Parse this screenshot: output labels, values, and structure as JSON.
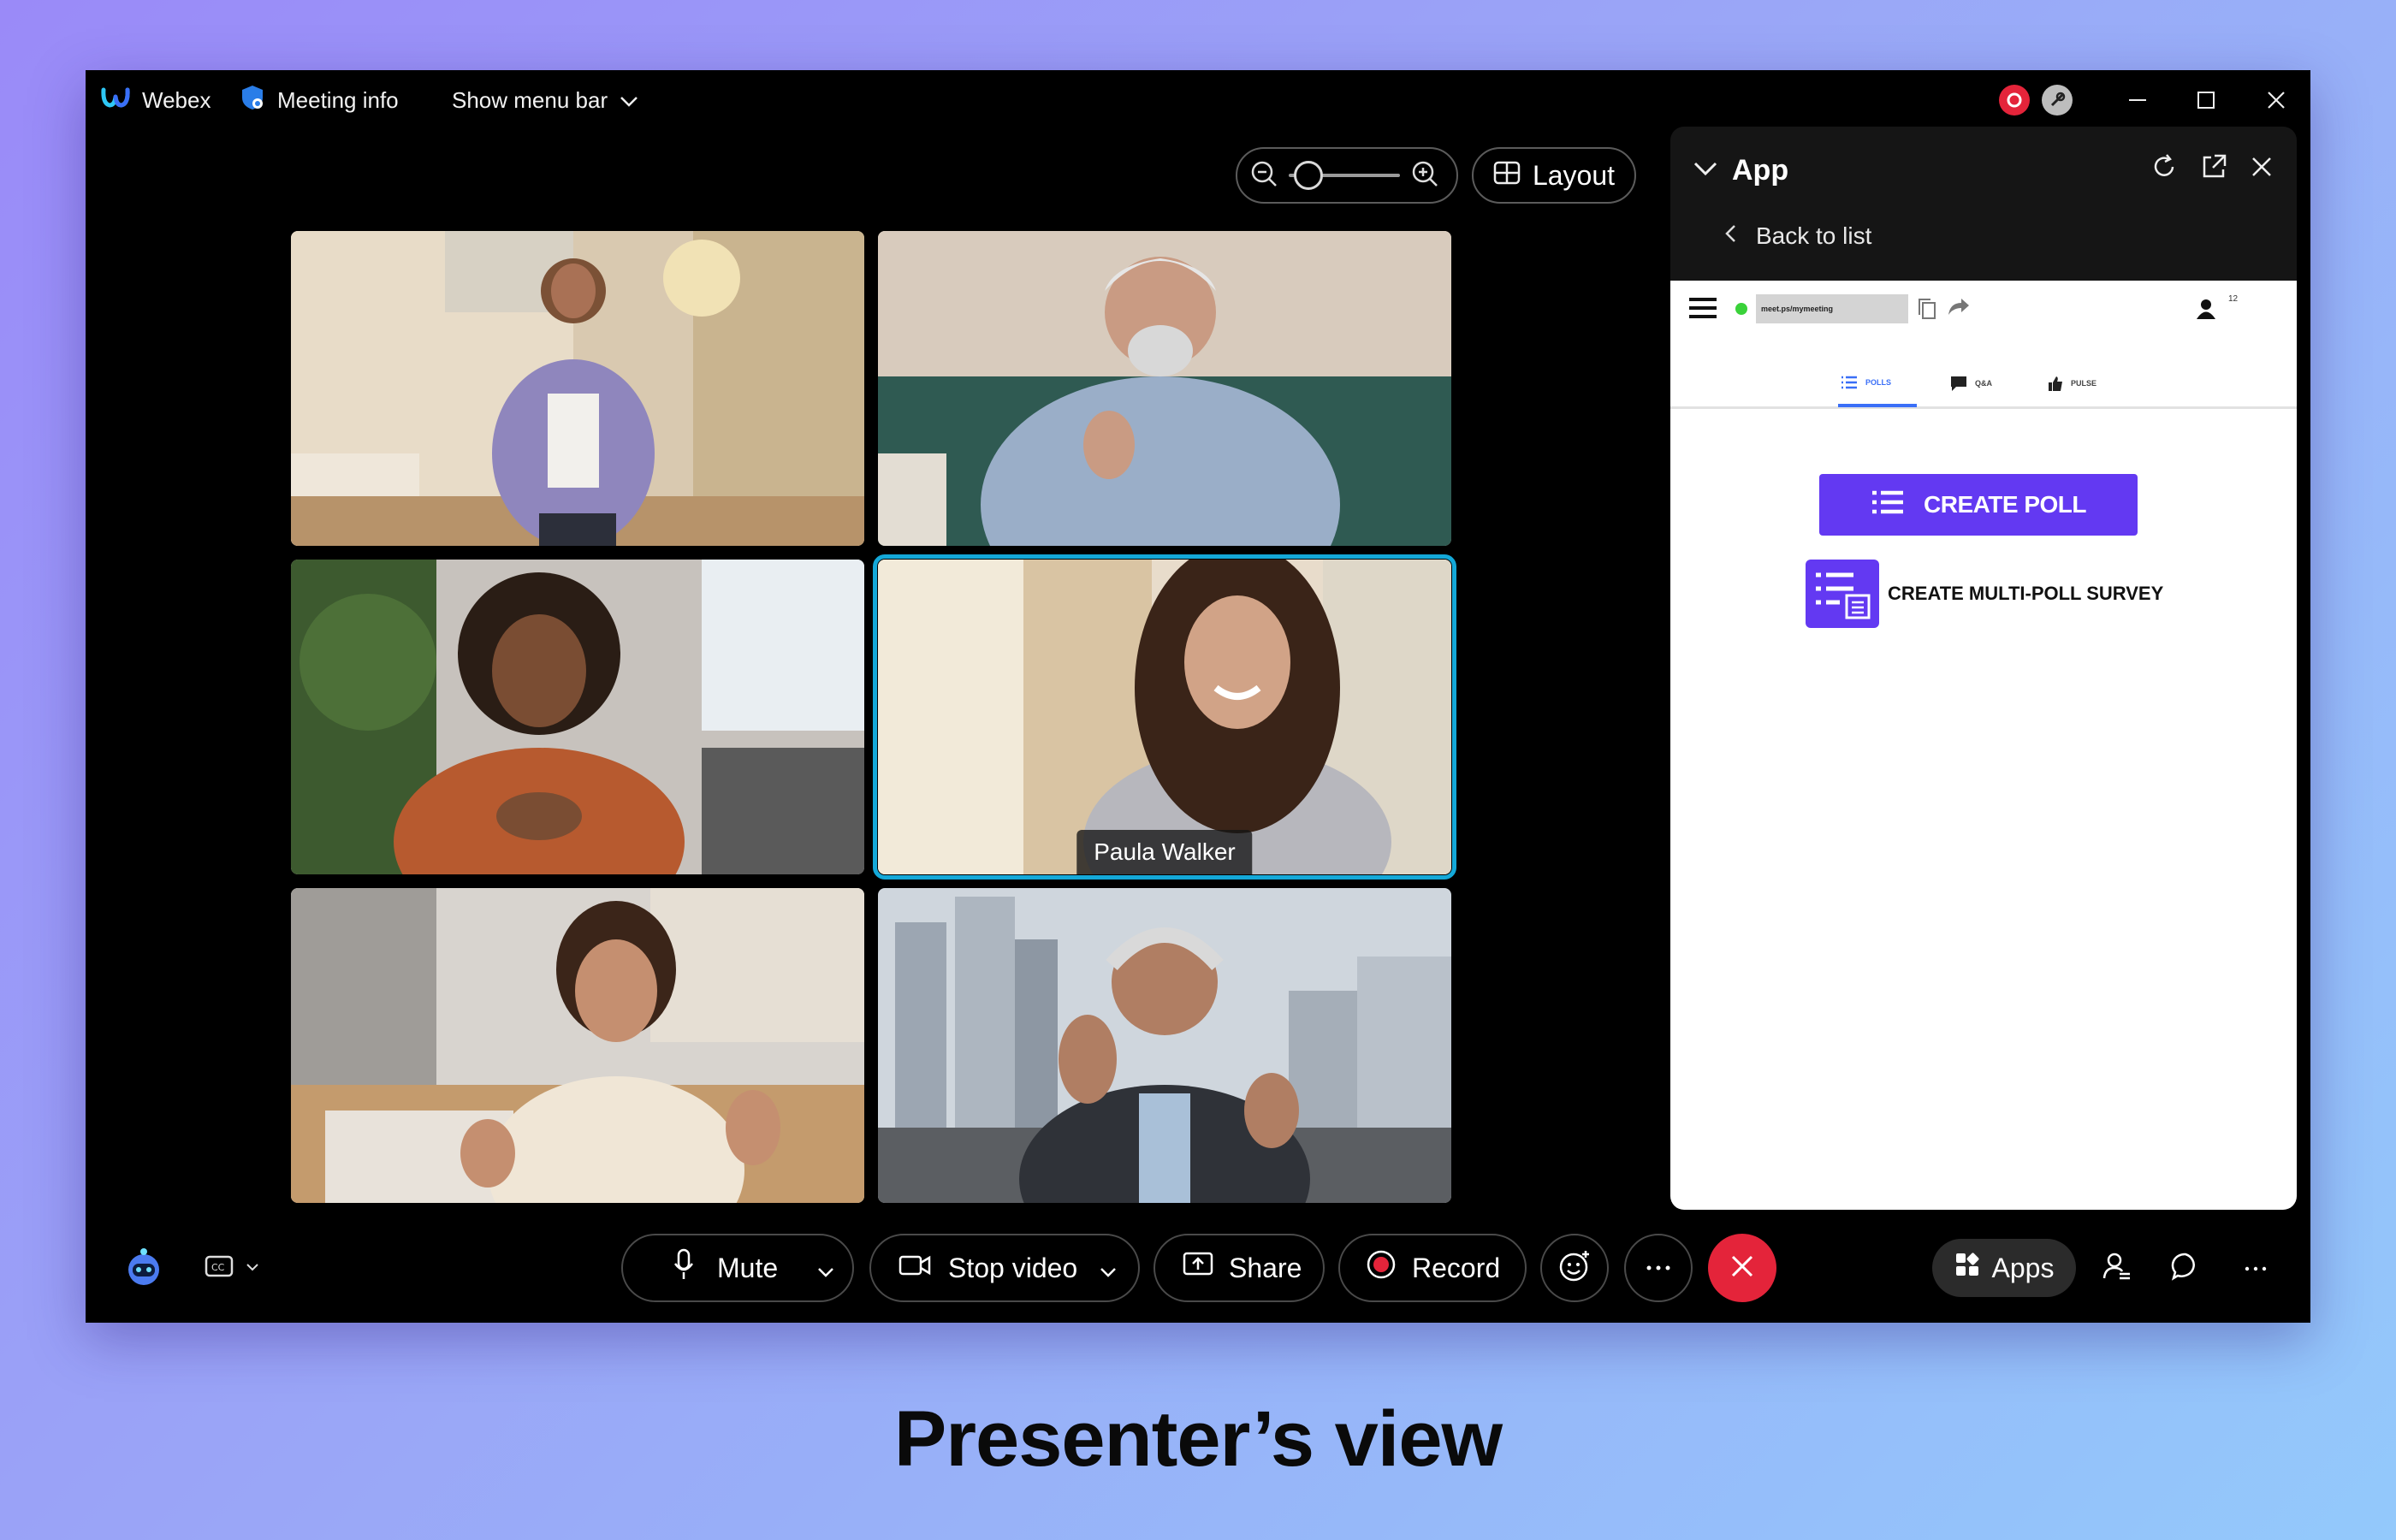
{
  "titlebar": {
    "app_name": "Webex",
    "meeting_info": "Meeting info",
    "show_menu_bar": "Show menu bar",
    "icons": [
      "webex-logo-icon",
      "shield-icon",
      "chevron-down-icon",
      "recording-indicator-icon",
      "link-indicator-icon",
      "minimize-icon",
      "maximize-icon",
      "close-icon"
    ]
  },
  "stage": {
    "layout_label": "Layout",
    "zoom_level": 0.1,
    "participants": [
      {
        "name": "",
        "active": false
      },
      {
        "name": "",
        "active": false
      },
      {
        "name": "",
        "active": false
      },
      {
        "name": "Paula Walker",
        "active": true
      },
      {
        "name": "",
        "active": false
      },
      {
        "name": "",
        "active": false
      }
    ]
  },
  "app_panel": {
    "title": "App",
    "back_label": "Back to list",
    "embed": {
      "url": "meet.ps/mymeeting",
      "participant_count": "12",
      "tabs": [
        "POLLS",
        "Q&A",
        "PULSE"
      ],
      "active_tab": "POLLS",
      "create_poll_label": "CREATE POLL",
      "multi_poll_label": "CREATE MULTI-POLL SURVEY"
    }
  },
  "toolbar": {
    "mute_label": "Mute",
    "stop_video_label": "Stop video",
    "share_label": "Share",
    "record_label": "Record",
    "apps_label": "Apps"
  },
  "caption": "Presenter’s view",
  "colors": {
    "accent_active": "#14a8d8",
    "end_call": "#e4243a",
    "poll_purple": "#6339f2",
    "record_red": "#e4243a"
  }
}
